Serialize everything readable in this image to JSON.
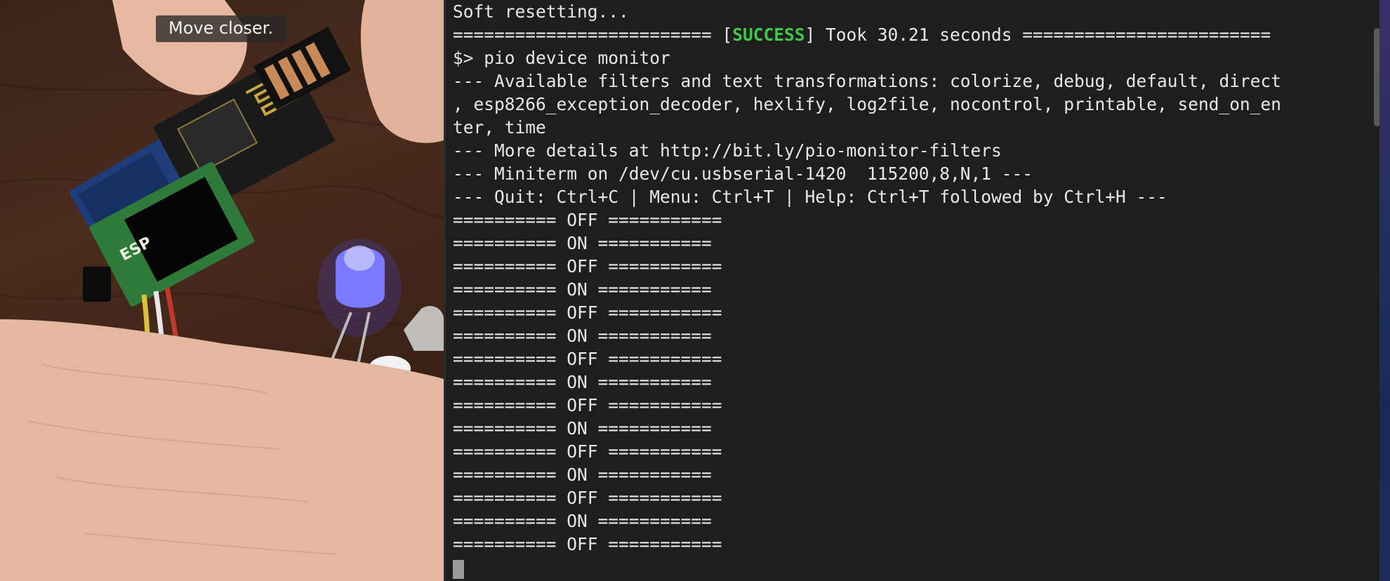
{
  "camera": {
    "caption": "Move closer.",
    "module_label": "ESP"
  },
  "terminal": {
    "lines": [
      "Soft resetting...",
      {
        "before": "========================= [",
        "highlight": "SUCCESS",
        "after": "] Took 30.21 seconds ========================"
      },
      "$> pio device monitor",
      "--- Available filters and text transformations: colorize, debug, default, direct",
      ", esp8266_exception_decoder, hexlify, log2file, nocontrol, printable, send_on_en",
      "ter, time",
      "--- More details at http://bit.ly/pio-monitor-filters",
      "--- Miniterm on /dev/cu.usbserial-1420  115200,8,N,1 ---",
      "--- Quit: Ctrl+C | Menu: Ctrl+T | Help: Ctrl+T followed by Ctrl+H ---",
      "========== OFF ===========",
      "========== ON ===========",
      "========== OFF ===========",
      "========== ON ===========",
      "========== OFF ===========",
      "========== ON ===========",
      "========== OFF ===========",
      "========== ON ===========",
      "========== OFF ===========",
      "========== ON ===========",
      "========== OFF ===========",
      "========== ON ===========",
      "========== OFF ===========",
      "========== ON ===========",
      "========== OFF ==========="
    ]
  },
  "colors": {
    "terminal_bg": "#1e1e1e",
    "terminal_fg": "#e8e8e8",
    "success": "#3fc84a",
    "cursor": "#9a9a9a"
  }
}
